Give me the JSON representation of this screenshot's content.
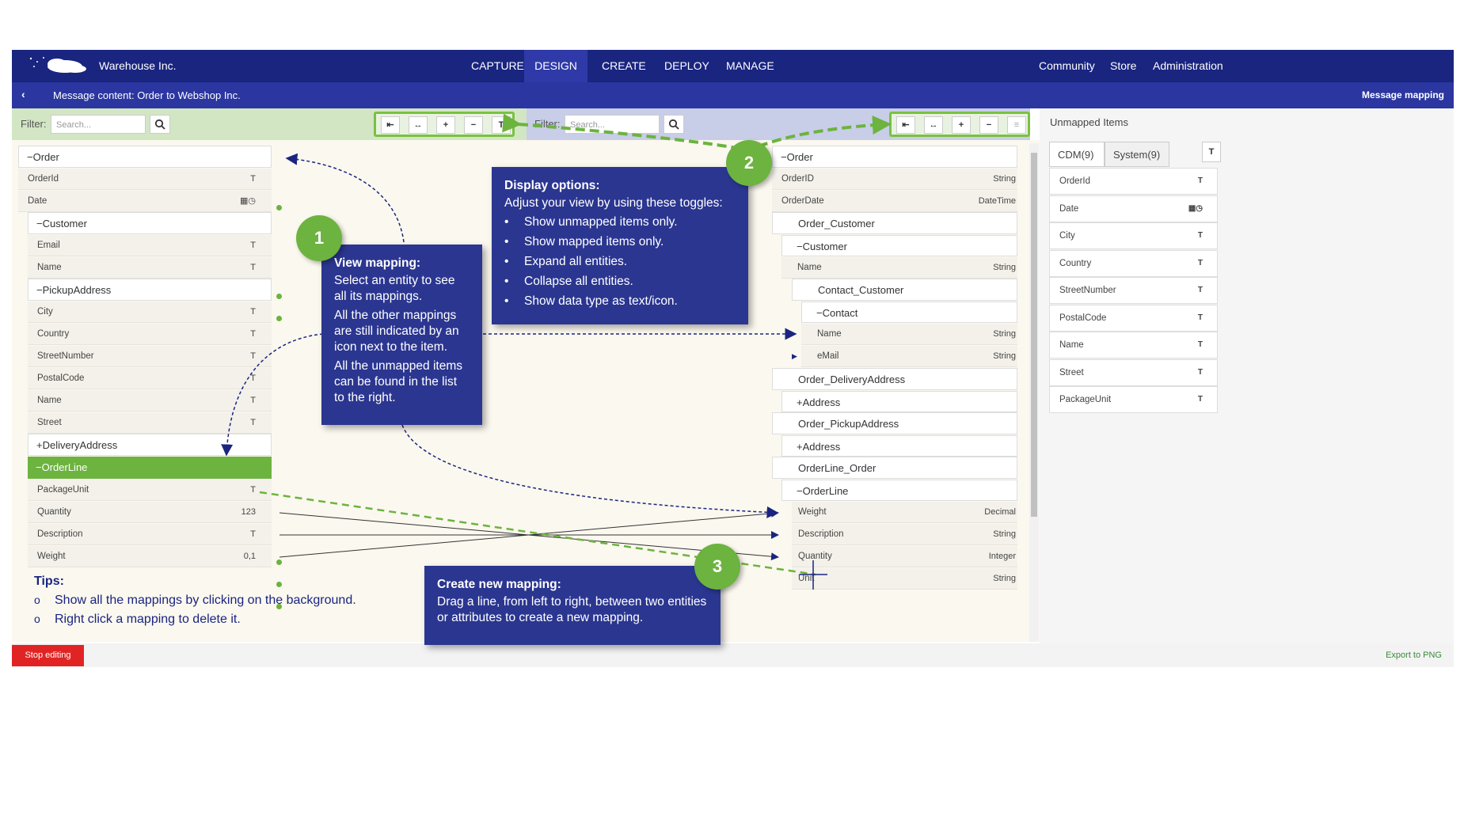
{
  "header": {
    "brand": "Warehouse Inc.",
    "nav": [
      "CAPTURE",
      "DESIGN",
      "CREATE",
      "DEPLOY",
      "MANAGE"
    ],
    "active_nav": "DESIGN",
    "right_nav": [
      "Community",
      "Store",
      "Administration"
    ]
  },
  "subheader": {
    "back": "‹",
    "title": "Message content: Order to Webshop Inc.",
    "right": "Message mapping"
  },
  "left_filter": {
    "label": "Filter:",
    "placeholder": "Search..."
  },
  "right_filter": {
    "label": "Filter:",
    "placeholder": "Search..."
  },
  "toggles": [
    "⇤",
    "↔",
    "+",
    "−",
    "T"
  ],
  "right_toggles": [
    "⇤",
    "↔",
    "+",
    "−",
    "≡"
  ],
  "left_tree": {
    "order": "Order",
    "order_rows": [
      {
        "label": "OrderId",
        "type": "T"
      },
      {
        "label": "Date",
        "type": "▦◷"
      }
    ],
    "customer": "Customer",
    "customer_rows": [
      {
        "label": "Email",
        "type": "T"
      },
      {
        "label": "Name",
        "type": "T"
      }
    ],
    "pickup": "PickupAddress",
    "pickup_rows": [
      {
        "label": "City",
        "type": "T"
      },
      {
        "label": "Country",
        "type": "T"
      },
      {
        "label": "StreetNumber",
        "type": "T"
      },
      {
        "label": "PostalCode",
        "type": "T"
      },
      {
        "label": "Name",
        "type": "T"
      },
      {
        "label": "Street",
        "type": "T"
      }
    ],
    "delivery": "DeliveryAddress",
    "orderline": "OrderLine",
    "orderline_rows": [
      {
        "label": "PackageUnit",
        "type": "T"
      },
      {
        "label": "Quantity",
        "type": "123"
      },
      {
        "label": "Description",
        "type": "T"
      },
      {
        "label": "Weight",
        "type": "0,1"
      }
    ]
  },
  "right_tree": {
    "order": "Order",
    "order_rows": [
      {
        "label": "OrderID",
        "type": "String"
      },
      {
        "label": "OrderDate",
        "type": "DateTime"
      }
    ],
    "order_customer": "Order_Customer",
    "customer": "Customer",
    "customer_name": {
      "label": "Name",
      "type": "String"
    },
    "contact_customer": "Contact_Customer",
    "contact": "Contact",
    "contact_rows": [
      {
        "label": "Name",
        "type": "String"
      },
      {
        "label": "eMail",
        "type": "String"
      }
    ],
    "order_delivery": "Order_DeliveryAddress",
    "address1": "Address",
    "order_pickup": "Order_PickupAddress",
    "address2": "Address",
    "orderline_order": "OrderLine_Order",
    "orderline": "OrderLine",
    "orderline_rows": [
      {
        "label": "Weight",
        "type": "Decimal"
      },
      {
        "label": "Description",
        "type": "String"
      },
      {
        "label": "Quantity",
        "type": "Integer"
      },
      {
        "label": "Unit",
        "type": "String"
      }
    ]
  },
  "unmapped": {
    "title": "Unmapped Items",
    "tabs": [
      "CDM(9)",
      "System(9)"
    ],
    "toggle": "T",
    "items": [
      {
        "label": "OrderId",
        "type": "T"
      },
      {
        "label": "Date",
        "type": "▦◷"
      },
      {
        "label": "City",
        "type": "T"
      },
      {
        "label": "Country",
        "type": "T"
      },
      {
        "label": "StreetNumber",
        "type": "T"
      },
      {
        "label": "PostalCode",
        "type": "T"
      },
      {
        "label": "Name",
        "type": "T"
      },
      {
        "label": "Street",
        "type": "T"
      },
      {
        "label": "PackageUnit",
        "type": "T"
      }
    ]
  },
  "bottom": {
    "stop": "Stop editing",
    "export": "Export to PNG"
  },
  "callout1": {
    "number": "1",
    "title": "View mapping:",
    "p1": "Select an entity to see all its mappings.",
    "p2": "All the other mappings are still indicated by an icon next to the item.",
    "p3": "All the unmapped items can be found in the list to the right."
  },
  "callout2": {
    "number": "2",
    "title": "Display options:",
    "intro": "Adjust your view by using these toggles:",
    "bullets": [
      "Show unmapped items only.",
      "Show mapped items only.",
      "Expand all entities.",
      "Collapse all entities.",
      "Show data type as text/icon."
    ]
  },
  "callout3": {
    "number": "3",
    "title": "Create new mapping:",
    "body": "Drag a line, from left to right, between two entities or attributes to create a new mapping."
  },
  "tips": {
    "title": "Tips:",
    "items": [
      "Show all the mappings by clicking on the background.",
      "Right click a mapping to delete it."
    ]
  },
  "colors": {
    "nav": "#1a2580",
    "subnav": "#2b36a0",
    "accent": "#6cb33f",
    "callout": "#2b3690",
    "stop": "#e02424"
  }
}
